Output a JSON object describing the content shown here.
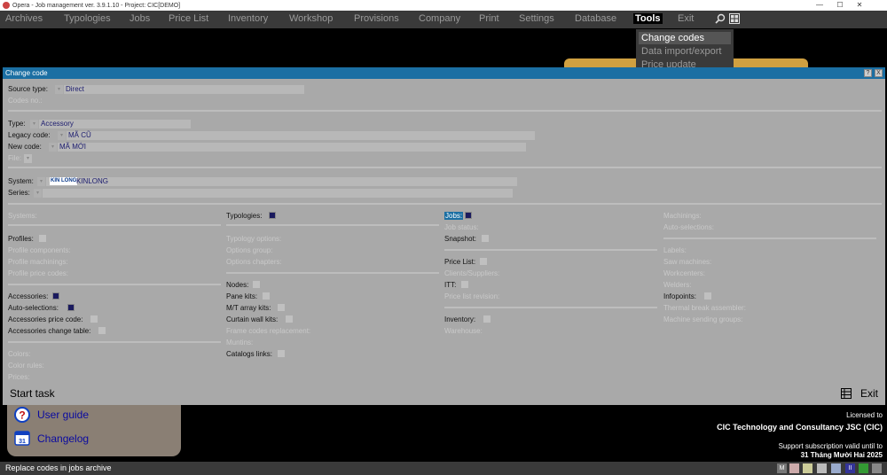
{
  "window": {
    "title": "Opera - Job management ver. 3.9.1.10 - Project: CIC[DEMO]",
    "minimize": "—",
    "maximize": "☐",
    "close": "✕"
  },
  "menu": {
    "items": [
      "Archives",
      "Typologies",
      "Jobs",
      "Price List",
      "Inventory",
      "Workshop",
      "Provisions",
      "Company",
      "Print",
      "Settings",
      "Database",
      "Tools",
      "Exit"
    ],
    "active": "Tools"
  },
  "tools_menu": {
    "items": [
      "Change codes",
      "Data import/export",
      "Price update"
    ]
  },
  "dialog": {
    "title": "Change code",
    "help_btn": "?",
    "close_btn": "X",
    "source_type_label": "Source type:",
    "source_type_value": "Direct",
    "codes_no_label": "Codes no.:",
    "type_label": "Type:",
    "type_value": "Accessory",
    "legacy_code_label": "Legacy code:",
    "legacy_code_value": "MÃ CŨ",
    "new_code_label": "New code:",
    "new_code_value": "MÃ MỚI",
    "file_label": "File:",
    "system_label": "System:",
    "system_brand": "KIN LONG",
    "system_value": "KINLONG",
    "series_label": "Series:",
    "col1": {
      "systems": "Systems:",
      "profiles": "Profiles:",
      "profile_components": "Profile components:",
      "profile_machinings": "Profile machinings:",
      "profile_price_codes": "Profile price codes:",
      "accessories": "Accessories:",
      "auto_selections": "Auto-selections:",
      "accessories_price_code": "Accessories price code:",
      "accessories_change_table": "Accessories change table:",
      "colors": "Colors:",
      "color_rules": "Color rules:",
      "prices": "Prices:"
    },
    "col2": {
      "typologies": "Typologies:",
      "typology_options": "Typology options:",
      "options_group": "Options group:",
      "options_chapters": "Options chapters:",
      "nodes": "Nodes:",
      "pane_kits": "Pane kits:",
      "mt_array_kits": "M/T array kits:",
      "curtain_wall_kits": "Curtain wall kits:",
      "frame_codes_replacement": "Frame codes replacement:",
      "muntins": "Muntins:",
      "catalogs_links": "Catalogs links:"
    },
    "col3": {
      "jobs": "Jobs:",
      "job_status": "Job status:",
      "snapshot": "Snapshot:",
      "price_list": "Price List:",
      "clients_suppliers": "Clients/Suppliers:",
      "itt": "ITT:",
      "price_list_revision": "Price list revision:",
      "inventory": "Inventory:",
      "warehouse": "Warehouse:"
    },
    "col4": {
      "machinings": "Machinings:",
      "auto_selections": "Auto-selections:",
      "labels": "Labels:",
      "saw_machines": "Saw machines:",
      "workcenters": "Workcenters:",
      "welders": "Welders:",
      "infopoints": "Infopoints:",
      "thermal_break_assembler": "Thermal break assembler:",
      "machine_sending_groups": "Machine sending groups:"
    },
    "start_task": "Start task",
    "exit": "Exit"
  },
  "guide": {
    "user_guide": "User guide",
    "changelog": "Changelog",
    "calendar_day": "31"
  },
  "license": {
    "licensed_to": "Licensed to",
    "company": "CIC Technology and Consultancy JSC (CIC)",
    "support": "Support subscription valid until to",
    "date": "31 Tháng Mười Hai 2025"
  },
  "status": {
    "text": "Replace codes in jobs archive"
  },
  "colors": {
    "dialog_title": "#1b6fa3",
    "menubar": "#3a3a3a",
    "dialog_bg": "#a9a9a9"
  }
}
